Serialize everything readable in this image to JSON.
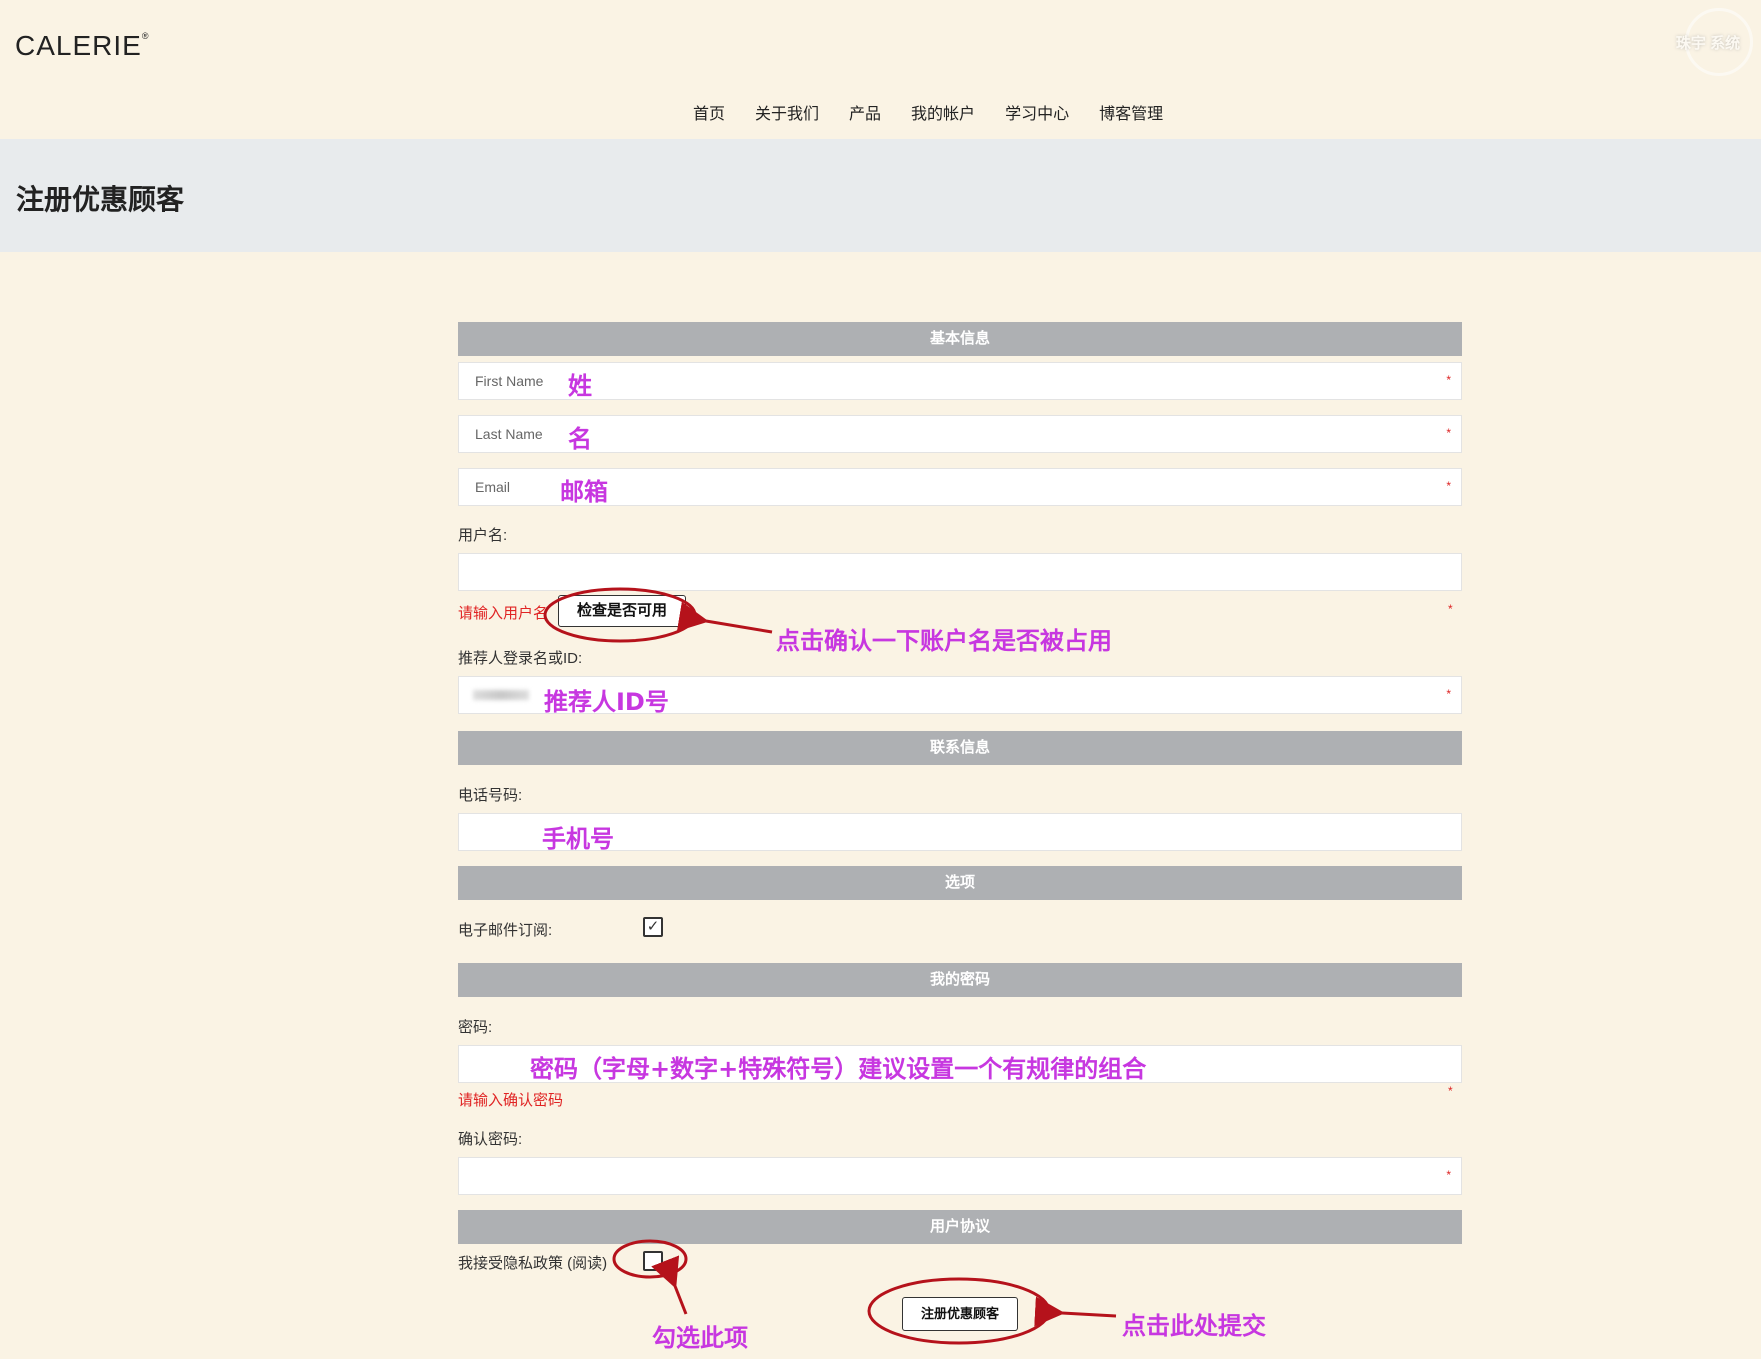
{
  "header": {
    "logo": "CALERIE",
    "logo_mark": "®",
    "watermark": "珠宇 系统"
  },
  "nav": {
    "items": [
      "首页",
      "关于我们",
      "产品",
      "我的帐户",
      "学习中心",
      "博客管理"
    ]
  },
  "page": {
    "title": "注册优惠顾客"
  },
  "form": {
    "sections": {
      "basic": "基本信息",
      "contact": "联系信息",
      "options": "选项",
      "password": "我的密码",
      "agreement": "用户协议"
    },
    "first_name": {
      "placeholder": "First Name",
      "required": "*"
    },
    "last_name": {
      "placeholder": "Last Name",
      "required": "*"
    },
    "email": {
      "placeholder": "Email",
      "required": "*"
    },
    "username": {
      "label": "用户名:",
      "error": "请输入用户名",
      "check_button": "检查是否可用",
      "required": "*"
    },
    "referrer": {
      "label": "推荐人登录名或ID:",
      "required": "*"
    },
    "phone": {
      "label": "电话号码:"
    },
    "newsletter": {
      "label": "电子邮件订阅:",
      "checked": true,
      "check_mark": "✓"
    },
    "password": {
      "label": "密码:",
      "error": "请输入确认密码",
      "required": "*"
    },
    "confirm_password": {
      "label": "确认密码:",
      "required": "*"
    },
    "privacy": {
      "label": "我接受隐私政策 (阅读)",
      "checked": false
    },
    "submit_button": "注册优惠顾客"
  },
  "annotations": {
    "first_name": "姓",
    "last_name": "名",
    "email": "邮箱",
    "check_username": "点击确认一下账户名是否被占用",
    "referrer": "推荐人ID号",
    "phone": "手机号",
    "password": "密码（字母+数字+特殊符号）建议设置一个有规律的组合",
    "privacy": "勾选此项",
    "submit": "点击此处提交"
  },
  "colors": {
    "background": "#faf3e4",
    "banner": "#e8ebed",
    "section_bar": "#aeb0b3",
    "annotation": "#c737e0",
    "circle": "#b5121b",
    "error": "#e02424"
  }
}
